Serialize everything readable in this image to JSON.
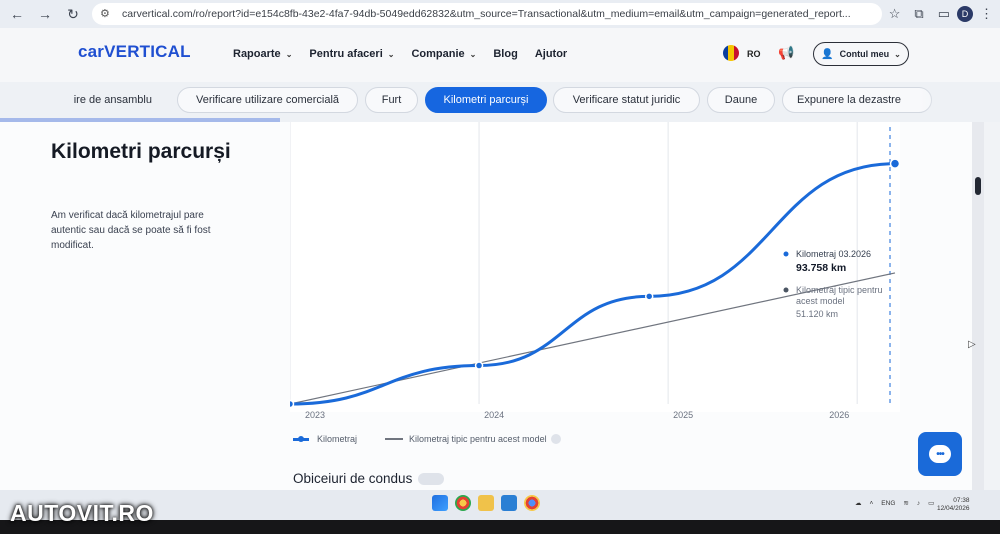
{
  "browser": {
    "url": "carvertical.com/ro/report?id=e154c8fb-43e2-4fa7-94db-5049edd62832&utm_source=Transactional&utm_medium=email&utm_campaign=generated_report...",
    "profile_initial": "D"
  },
  "header": {
    "logo": "carVERTICAL",
    "nav": [
      {
        "label": "Rapoarte",
        "dropdown": true
      },
      {
        "label": "Pentru afaceri",
        "dropdown": true
      },
      {
        "label": "Companie",
        "dropdown": true
      },
      {
        "label": "Blog",
        "dropdown": false
      },
      {
        "label": "Ajutor",
        "dropdown": false
      }
    ],
    "lang": "RO",
    "account": "Contul meu"
  },
  "tabs": [
    {
      "label": "ire de ansamblu",
      "active": false
    },
    {
      "label": "Verificare utilizare comercială",
      "active": false
    },
    {
      "label": "Furt",
      "active": false
    },
    {
      "label": "Kilometri parcurși",
      "active": true
    },
    {
      "label": "Verificare statut juridic",
      "active": false
    },
    {
      "label": "Daune",
      "active": false
    },
    {
      "label": "Expunere la dezastre",
      "active": false
    }
  ],
  "section": {
    "title": "Kilometri parcurși",
    "description": "Am verificat dacă kilometrajul pare autentic sau dacă se poate să fi fost modificat."
  },
  "chart_data": {
    "type": "line",
    "x_ticks": [
      "2023",
      "2024",
      "2025",
      "2026"
    ],
    "series": [
      {
        "name": "Kilometraj",
        "color": "#1a6ad9",
        "x": [
          2023.0,
          2024.0,
          2024.9,
          2026.2
        ],
        "y": [
          0,
          15000,
          42000,
          93758
        ]
      },
      {
        "name": "Kilometraj tipic pentru acest model",
        "color": "#70757f",
        "x": [
          2023.0,
          2026.2
        ],
        "y": [
          0,
          51120
        ]
      }
    ],
    "tooltip": {
      "primary_label": "Kilometraj 03.2026",
      "primary_value": "93.758 km",
      "secondary_label": "Kilometraj tipic pentru acest model",
      "secondary_value": "51.120 km"
    },
    "legend_placement": "bottom-left",
    "grid": true
  },
  "legend": {
    "series1": "Kilometraj",
    "series2": "Kilometraj tipic pentru acest model"
  },
  "next_section": "Obiceiuri de condus",
  "taskbar": {
    "lang": "ENG",
    "time": "07:38",
    "date": "12/04/2026"
  },
  "watermark": "AUTOVIT.RO",
  "colors": {
    "accent": "#1666e0",
    "brand": "#1f4fd1",
    "chart_line": "#1a6ad9",
    "typical_line": "#70757f"
  }
}
